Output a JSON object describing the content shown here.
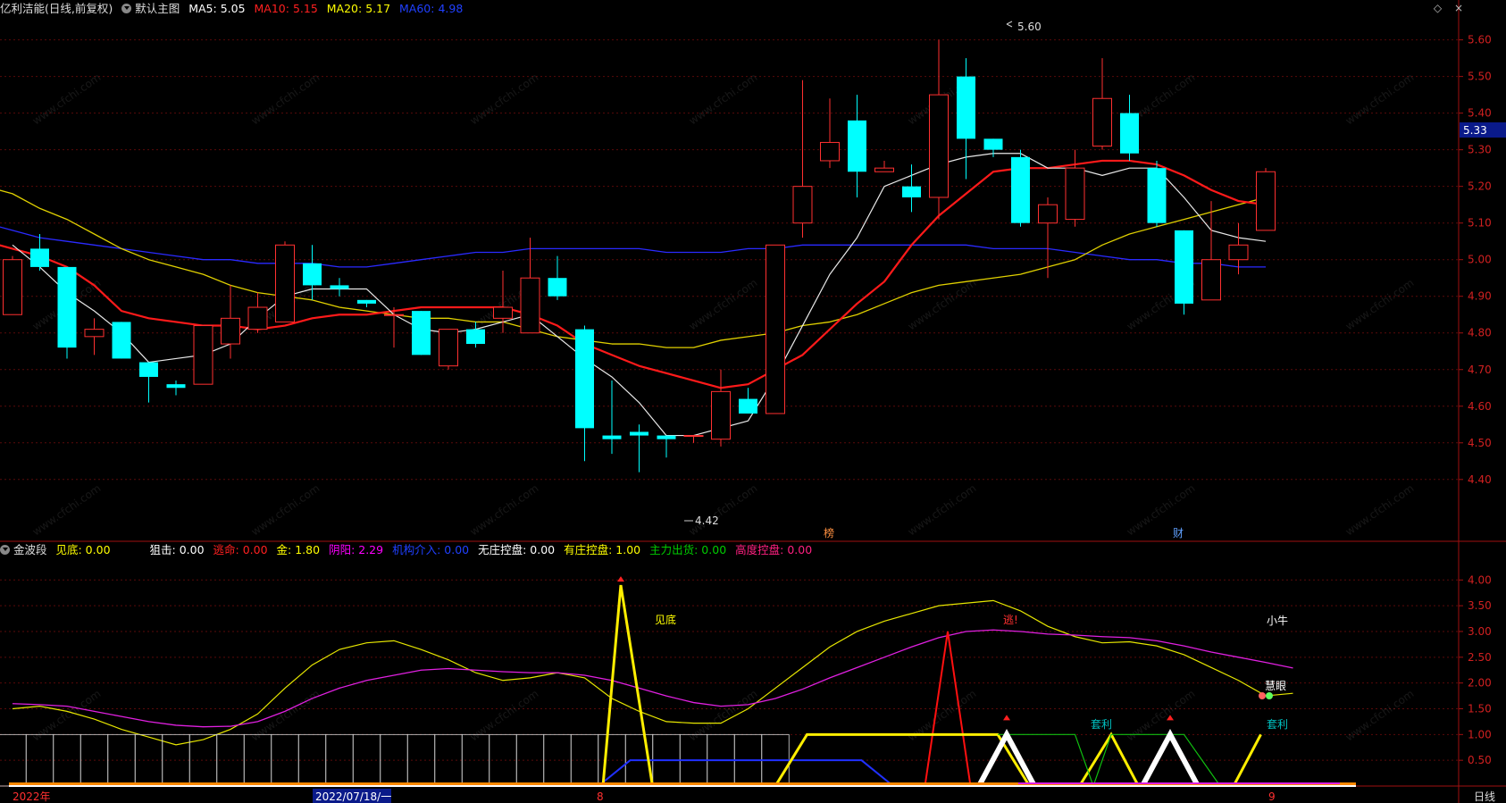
{
  "header": {
    "stock_title": "亿利洁能(日线,前复权)",
    "main_chart_name": "默认主图",
    "ma": [
      {
        "label": "MA5: 5.05",
        "color": "#ffffff"
      },
      {
        "label": "MA10: 5.15",
        "color": "#ff2020"
      },
      {
        "label": "MA20: 5.17",
        "color": "#ffff00"
      },
      {
        "label": "MA60: 4.98",
        "color": "#2020ff"
      }
    ]
  },
  "toolbar": {
    "diamond_icon": "◇",
    "close_icon": "×"
  },
  "price_axis": {
    "ticks": [
      "5.60",
      "5.50",
      "5.40",
      "5.30",
      "5.20",
      "5.10",
      "5.00",
      "4.90",
      "4.80",
      "4.70",
      "4.60",
      "4.50",
      "4.40"
    ],
    "current_price": "5.33"
  },
  "annotations": {
    "high_label": "5.60",
    "low_label": "4.42",
    "tag_bang": "榜",
    "tag_cai": "财"
  },
  "indicator": {
    "name": "金波段",
    "values": [
      {
        "label": "见底: 0.00",
        "color": "#ffff00"
      },
      {
        "label": "狙击: 0.00",
        "color": "#ffffff"
      },
      {
        "label": "逃命: 0.00",
        "color": "#ff2020"
      },
      {
        "label": "金: 1.80",
        "color": "#ffff00"
      },
      {
        "label": "阴阳: 2.29",
        "color": "#ff00ff"
      },
      {
        "label": "机构介入: 0.00",
        "color": "#2020ff"
      },
      {
        "label": "无庄控盘: 0.00",
        "color": "#ffffff"
      },
      {
        "label": "有庄控盘: 1.00",
        "color": "#ffff00"
      },
      {
        "label": "主力出货: 0.00",
        "color": "#00cc00"
      },
      {
        "label": "高度控盘: 0.00",
        "color": "#ff2080"
      }
    ],
    "ticks": [
      "4.00",
      "3.50",
      "3.00",
      "2.50",
      "2.00",
      "1.50",
      "1.00",
      "0.50"
    ],
    "labels": {
      "jiandi": "见底",
      "tao": "逃!",
      "taoli": "套利",
      "xiaoniu": "小牛",
      "huiyan": "慧眼"
    }
  },
  "date_axis": {
    "labels": [
      "2022年",
      "2022/07/18/一",
      "8",
      "9"
    ],
    "period": "日线"
  },
  "chart_data": {
    "type": "candlestick",
    "ylim": [
      4.38,
      5.66
    ],
    "candles": [
      [
        4.85,
        5.0,
        4.93,
        5.01
      ],
      [
        5.03,
        4.98,
        4.97,
        5.07
      ],
      [
        4.98,
        4.76,
        4.73,
        4.98
      ],
      [
        4.79,
        4.81,
        4.74,
        4.84
      ],
      [
        4.83,
        4.73,
        4.73,
        4.83
      ],
      [
        4.72,
        4.68,
        4.61,
        4.72
      ],
      [
        4.66,
        4.65,
        4.63,
        4.67
      ],
      [
        4.66,
        4.82,
        4.66,
        4.82
      ],
      [
        4.77,
        4.84,
        4.73,
        4.93
      ],
      [
        4.81,
        4.87,
        4.8,
        4.91
      ],
      [
        4.83,
        5.04,
        4.83,
        5.05
      ],
      [
        4.99,
        4.93,
        4.89,
        5.04
      ],
      [
        4.93,
        4.92,
        4.9,
        4.95
      ],
      [
        4.89,
        4.88,
        4.87,
        4.89
      ],
      [
        4.85,
        4.85,
        4.76,
        4.87
      ],
      [
        4.86,
        4.74,
        4.74,
        4.86
      ],
      [
        4.71,
        4.81,
        4.7,
        4.81
      ],
      [
        4.81,
        4.77,
        4.76,
        4.83
      ],
      [
        4.84,
        4.87,
        4.8,
        4.97
      ],
      [
        4.8,
        4.95,
        4.8,
        5.06
      ],
      [
        4.95,
        4.9,
        4.89,
        5.01
      ],
      [
        4.81,
        4.54,
        4.45,
        4.82
      ],
      [
        4.52,
        4.51,
        4.47,
        4.67
      ],
      [
        4.53,
        4.52,
        4.42,
        4.55
      ],
      [
        4.52,
        4.51,
        4.46,
        4.52
      ],
      [
        4.52,
        4.52,
        4.5,
        4.52
      ],
      [
        4.51,
        4.64,
        4.49,
        4.7
      ],
      [
        4.62,
        4.58,
        4.58,
        4.65
      ],
      [
        4.58,
        5.04,
        4.58,
        5.04
      ],
      [
        5.1,
        5.2,
        5.06,
        5.49
      ],
      [
        5.27,
        5.32,
        5.25,
        5.44
      ],
      [
        5.38,
        5.24,
        5.17,
        5.45
      ],
      [
        5.24,
        5.25,
        5.24,
        5.27
      ],
      [
        5.2,
        5.17,
        5.13,
        5.26
      ],
      [
        5.17,
        5.45,
        5.11,
        5.6
      ],
      [
        5.5,
        5.33,
        5.22,
        5.55
      ],
      [
        5.33,
        5.3,
        5.28,
        5.33
      ],
      [
        5.28,
        5.1,
        5.09,
        5.3
      ],
      [
        5.1,
        5.15,
        4.95,
        5.17
      ],
      [
        5.11,
        5.25,
        5.09,
        5.3
      ],
      [
        5.31,
        5.44,
        5.3,
        5.55
      ],
      [
        5.4,
        5.29,
        5.27,
        5.45
      ],
      [
        5.25,
        5.1,
        5.09,
        5.27
      ],
      [
        5.08,
        4.88,
        4.85,
        5.08
      ],
      [
        4.89,
        5.0,
        4.89,
        5.16
      ],
      [
        5.0,
        5.04,
        4.96,
        5.1
      ],
      [
        5.08,
        5.24,
        5.08,
        5.25
      ]
    ],
    "ma5": [
      5.04,
      4.98,
      4.91,
      4.86,
      4.8,
      4.72,
      4.73,
      4.74,
      4.77,
      4.84,
      4.9,
      4.92,
      4.92,
      4.92,
      4.85,
      4.81,
      4.8,
      4.81,
      4.83,
      4.85,
      4.79,
      4.73,
      4.68,
      4.61,
      4.52,
      4.52,
      4.54,
      4.56,
      4.68,
      4.82,
      4.96,
      5.06,
      5.2,
      5.23,
      5.26,
      5.28,
      5.29,
      5.29,
      5.25,
      5.25,
      5.23,
      5.25,
      5.25,
      5.17,
      5.08,
      5.06,
      5.05
    ],
    "ma10": [
      5.05,
      5.03,
      5.01,
      4.98,
      4.93,
      4.86,
      4.84,
      4.83,
      4.82,
      4.82,
      4.81,
      4.82,
      4.84,
      4.85,
      4.85,
      4.86,
      4.87,
      4.87,
      4.87,
      4.87,
      4.85,
      4.82,
      4.77,
      4.74,
      4.71,
      4.69,
      4.67,
      4.65,
      4.66,
      4.7,
      4.74,
      4.81,
      4.88,
      4.94,
      5.04,
      5.12,
      5.18,
      5.24,
      5.25,
      5.25,
      5.26,
      5.27,
      5.27,
      5.26,
      5.23,
      5.19,
      5.16,
      5.15
    ],
    "ma20": [
      5.2,
      5.18,
      5.14,
      5.11,
      5.07,
      5.03,
      5.0,
      4.98,
      4.96,
      4.93,
      4.91,
      4.9,
      4.89,
      4.87,
      4.86,
      4.85,
      4.84,
      4.84,
      4.83,
      4.83,
      4.81,
      4.79,
      4.78,
      4.77,
      4.77,
      4.76,
      4.76,
      4.78,
      4.79,
      4.8,
      4.82,
      4.83,
      4.85,
      4.88,
      4.91,
      4.93,
      4.94,
      4.95,
      4.96,
      4.98,
      5.0,
      5.04,
      5.07,
      5.09,
      5.11,
      5.13,
      5.15,
      5.17
    ],
    "ma60": [
      5.1,
      5.08,
      5.06,
      5.05,
      5.04,
      5.03,
      5.02,
      5.01,
      5.0,
      5.0,
      4.99,
      4.99,
      4.99,
      4.98,
      4.98,
      4.99,
      5.0,
      5.01,
      5.02,
      5.02,
      5.03,
      5.03,
      5.03,
      5.03,
      5.03,
      5.02,
      5.02,
      5.02,
      5.03,
      5.03,
      5.04,
      5.04,
      5.04,
      5.04,
      5.04,
      5.04,
      5.04,
      5.03,
      5.03,
      5.03,
      5.02,
      5.01,
      5.0,
      5.0,
      4.99,
      4.99,
      4.98,
      4.98
    ],
    "indicator_ylim": [
      0,
      4.3
    ],
    "gold": [
      1.5,
      1.55,
      1.45,
      1.3,
      1.1,
      0.95,
      0.8,
      0.9,
      1.1,
      1.4,
      1.9,
      2.35,
      2.65,
      2.78,
      2.82,
      2.65,
      2.45,
      2.2,
      2.05,
      2.1,
      2.2,
      2.1,
      1.7,
      1.45,
      1.25,
      1.22,
      1.22,
      1.5,
      1.9,
      2.3,
      2.7,
      3.0,
      3.2,
      3.35,
      3.5,
      3.55,
      3.6,
      3.4,
      3.1,
      2.9,
      2.78,
      2.8,
      2.72,
      2.55,
      2.3,
      2.05,
      1.75,
      1.8
    ],
    "yinyang": [
      1.6,
      1.58,
      1.55,
      1.45,
      1.35,
      1.25,
      1.18,
      1.15,
      1.16,
      1.25,
      1.45,
      1.7,
      1.9,
      2.05,
      2.15,
      2.25,
      2.28,
      2.25,
      2.22,
      2.2,
      2.2,
      2.15,
      2.05,
      1.9,
      1.75,
      1.62,
      1.55,
      1.58,
      1.7,
      1.88,
      2.1,
      2.3,
      2.5,
      2.7,
      2.88,
      3.0,
      3.03,
      3.0,
      2.95,
      2.93,
      2.9,
      2.88,
      2.82,
      2.72,
      2.6,
      2.5,
      2.4,
      2.29
    ],
    "baseline_bars": 29
  }
}
